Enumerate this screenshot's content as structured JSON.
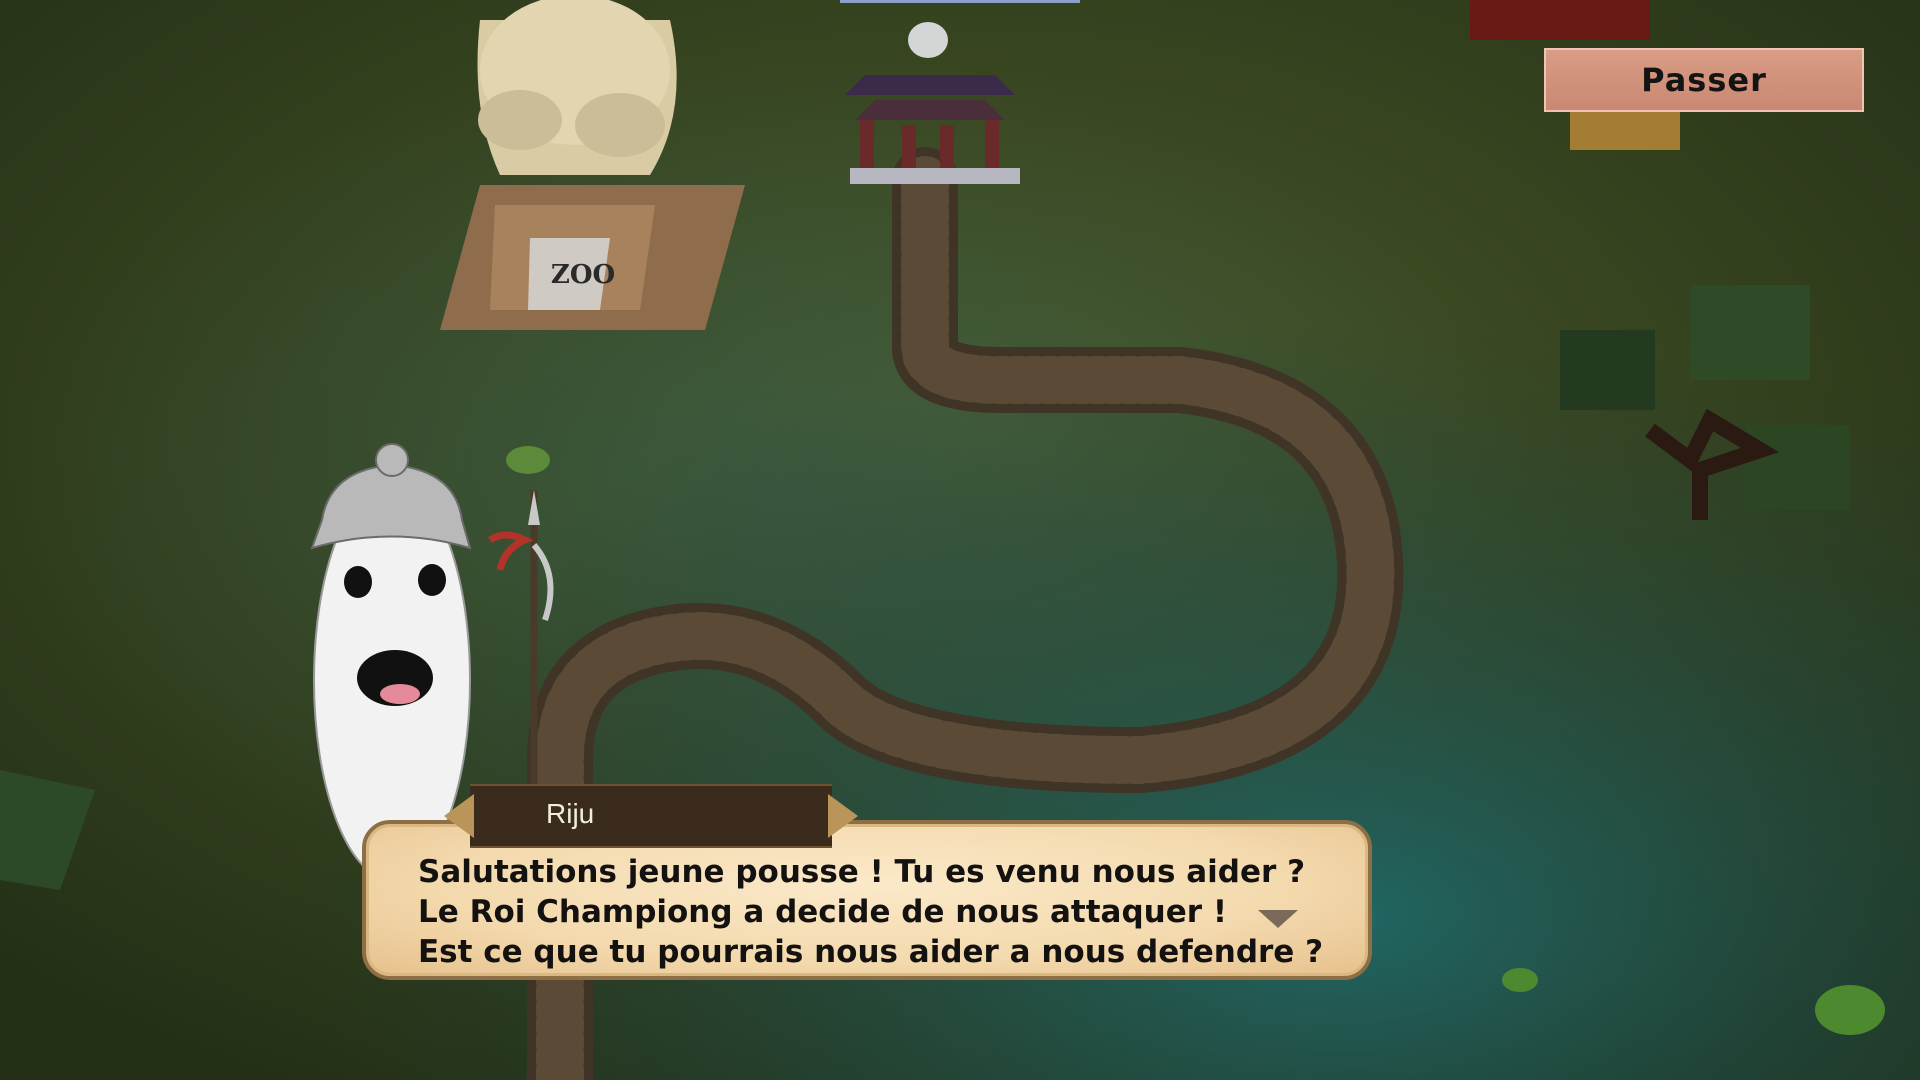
{
  "hud": {
    "skip_label": "Passer"
  },
  "world": {
    "statue_plaque": "ZOO"
  },
  "dialogue": {
    "speaker": "Riju",
    "lines": [
      "Salutations jeune pousse ! Tu es venu nous aider ?",
      "Le Roi Championg a decide de nous attaquer !",
      "Est ce que tu pourrais nous aider a nous defendre ?"
    ]
  },
  "colors": {
    "skip_button": "#d99c84",
    "dialog_parchment": "#f3d9ad",
    "speaker_plate": "#3a2b1c"
  },
  "icons": {
    "continue": "chevron-down-icon"
  }
}
